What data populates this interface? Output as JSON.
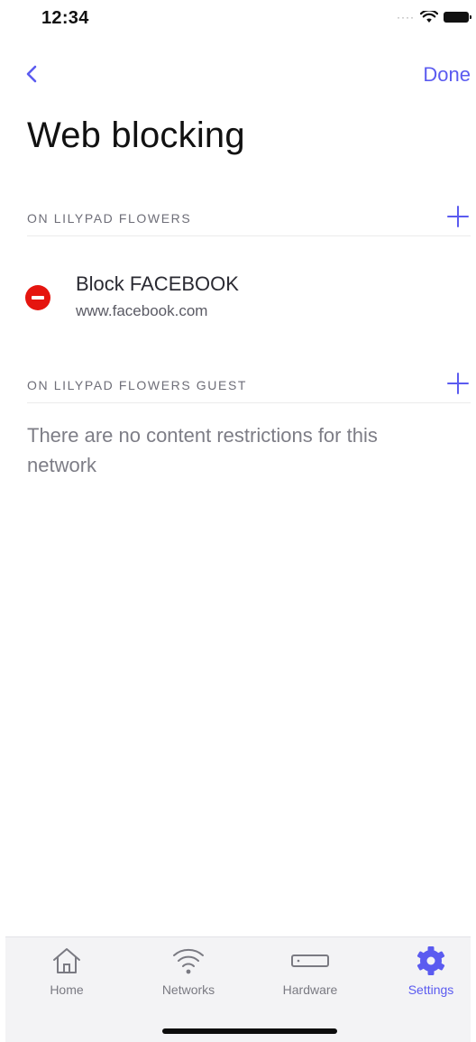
{
  "status_bar": {
    "time": "12:34"
  },
  "nav": {
    "done_label": "Done"
  },
  "page": {
    "title": "Web blocking"
  },
  "sections": [
    {
      "label": "ON LILYPAD FLOWERS",
      "rules": [
        {
          "title": "Block FACEBOOK",
          "subtitle": "www.facebook.com"
        }
      ]
    },
    {
      "label": "ON LILYPAD FLOWERS GUEST",
      "empty_message": "There are no content restrictions for this network"
    }
  ],
  "tabs": [
    {
      "label": "Home",
      "icon": "home-icon",
      "active": false
    },
    {
      "label": "Networks",
      "icon": "wifi-icon",
      "active": false
    },
    {
      "label": "Hardware",
      "icon": "router-icon",
      "active": false
    },
    {
      "label": "Settings",
      "icon": "gear-icon",
      "active": true
    }
  ],
  "colors": {
    "accent": "#5b5bf0",
    "remove": "#e5150f",
    "tab_bar_bg": "#f3f3f5"
  }
}
